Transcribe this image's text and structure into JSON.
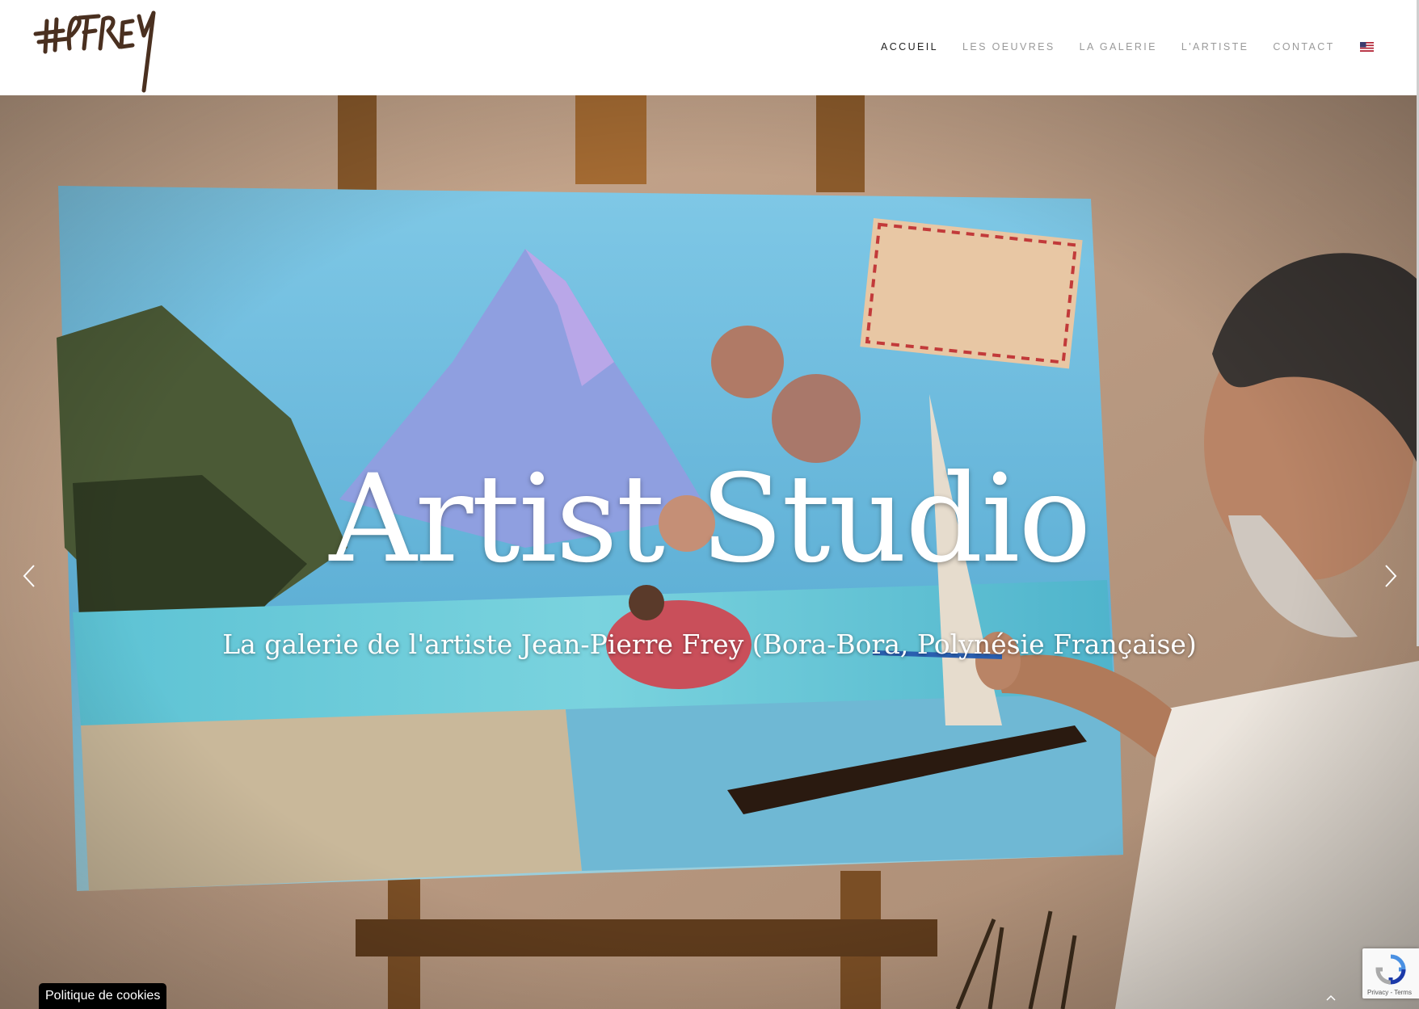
{
  "header": {
    "nav": [
      {
        "label": "ACCUEIL",
        "active": true
      },
      {
        "label": "LES OEUVRES",
        "active": false
      },
      {
        "label": "LA GALERIE",
        "active": false
      },
      {
        "label": "L'ARTISTE",
        "active": false
      },
      {
        "label": "CONTACT",
        "active": false
      }
    ],
    "language_flag_icon": "us-flag-icon"
  },
  "hero": {
    "title": "Artist Studio",
    "subtitle": "La galerie de l'artiste Jean-Pierre Frey (Bora-Bora, Polynésie Française)",
    "prev_icon": "chevron-left-icon",
    "next_icon": "chevron-right-icon"
  },
  "cookie": {
    "label": "Politique de cookies"
  },
  "recaptcha": {
    "links": "Privacy - Terms"
  },
  "colors": {
    "nav_active": "#222222",
    "nav_inactive": "#9a9a9a",
    "logo_ink": "#4a3020",
    "cookie_bg": "#000000"
  }
}
